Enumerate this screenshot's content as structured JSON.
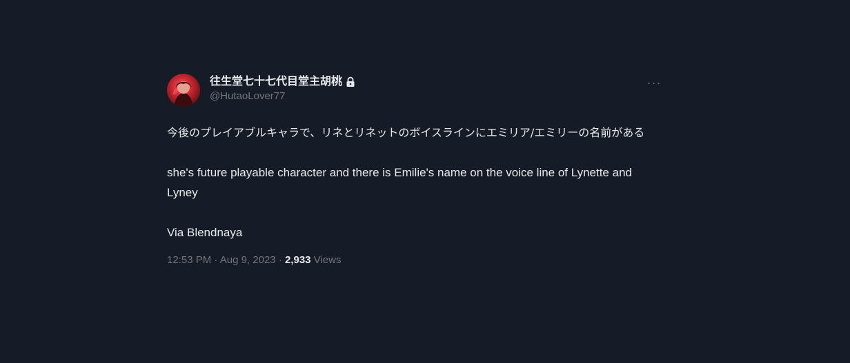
{
  "tweet": {
    "author": {
      "display_name": "往生堂七十七代目堂主胡桃",
      "handle": "@HutaoLover77",
      "protected_icon": "lock-icon",
      "avatar_icon": "avatar"
    },
    "more_label": "···",
    "text": {
      "jp_line": "今後のプレイアブルキャラで、リネとリネットのボイスラインにエミリア/エミリーの名前がある",
      "en_line": "she's future playable character and there is Emilie's name on the voice line of Lynette and Lyney",
      "via_line": "Via Blendnaya"
    },
    "meta": {
      "time": "12:53 PM",
      "sep1": " · ",
      "date": "Aug 9, 2023",
      "sep2": " · ",
      "views_count": "2,933",
      "views_label": " Views"
    }
  },
  "colors": {
    "background": "#161c27",
    "text_primary": "#e7e9ea",
    "text_secondary": "#71767b",
    "avatar_red": "#c8262f"
  }
}
